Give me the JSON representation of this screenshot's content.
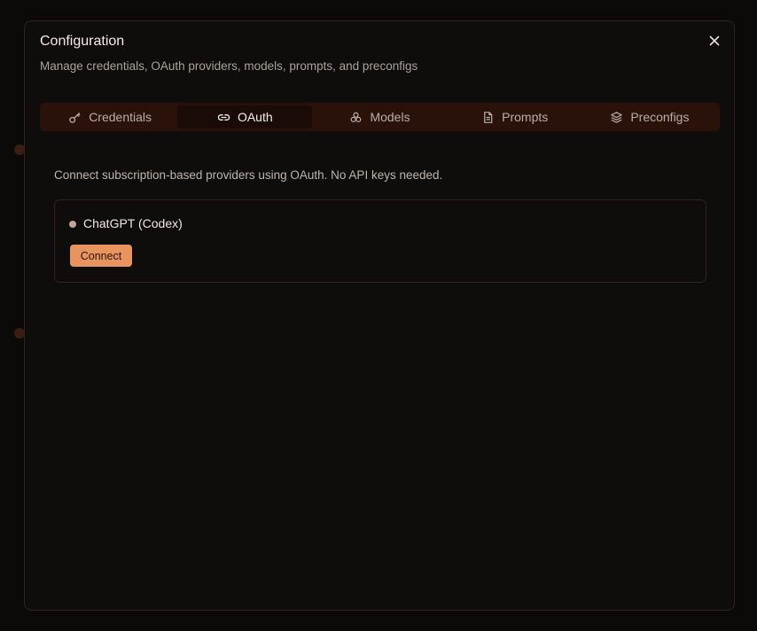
{
  "modal": {
    "title": "Configuration",
    "subtitle": "Manage credentials, OAuth providers, models, prompts, and preconfigs",
    "close_icon": "close-icon"
  },
  "tabs": [
    {
      "label": "Credentials",
      "icon": "key-icon",
      "active": false
    },
    {
      "label": "OAuth",
      "icon": "link-icon",
      "active": true
    },
    {
      "label": "Models",
      "icon": "boxes-icon",
      "active": false
    },
    {
      "label": "Prompts",
      "icon": "document-icon",
      "active": false
    },
    {
      "label": "Preconfigs",
      "icon": "layers-icon",
      "active": false
    }
  ],
  "oauth": {
    "description": "Connect subscription-based providers using OAuth. No API keys needed.",
    "providers": [
      {
        "name": "ChatGPT (Codex)",
        "connect_label": "Connect",
        "status_color": "#bfa898"
      }
    ]
  },
  "colors": {
    "accent": "#e9945e",
    "tab_bar": "#2a120a",
    "modal_bg": "#0f0d0c"
  }
}
